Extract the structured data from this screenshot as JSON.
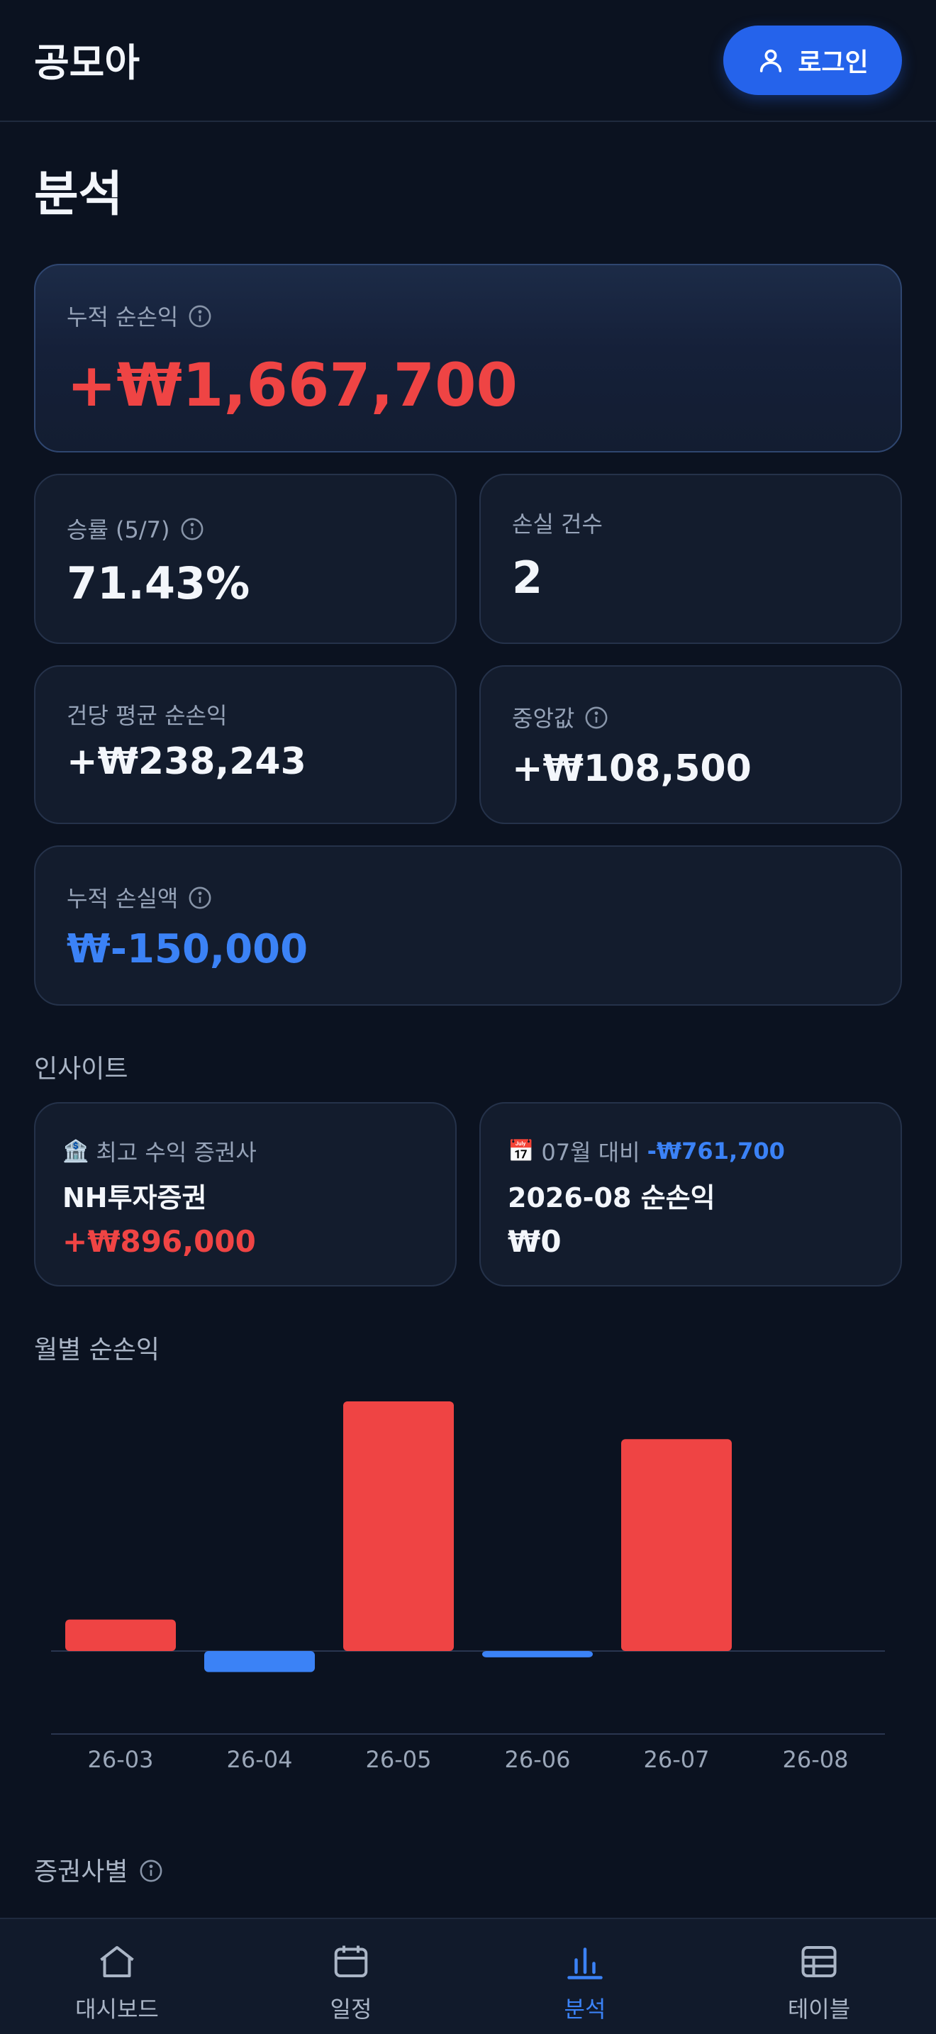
{
  "header": {
    "brand": "공모아",
    "login_label": "로그인"
  },
  "page": {
    "title": "분석"
  },
  "stats": {
    "cumulative_net": {
      "label": "누적 순손익",
      "value": "+₩1,667,700"
    },
    "win_rate": {
      "label": "승률 (5/7)",
      "value": "71.43%"
    },
    "loss_count": {
      "label": "손실 건수",
      "value": "2"
    },
    "avg_net": {
      "label": "건당 평균 순손익",
      "value": "+₩238,243"
    },
    "median": {
      "label": "중앙값",
      "value": "+₩108,500"
    },
    "cumulative_loss": {
      "label": "누적 손실액",
      "value": "₩-150,000"
    }
  },
  "insights": {
    "title": "인사이트",
    "top_broker": {
      "icon": "bank-icon",
      "label": "최고 수익 증권사",
      "name": "NH투자증권",
      "value": "+₩896,000"
    },
    "month_compare": {
      "icon": "calendar-icon",
      "label": "07월 대비",
      "delta": "-₩761,700",
      "name": "2026-08 순손익",
      "value": "₩0"
    }
  },
  "monthly": {
    "title": "월별 순손익"
  },
  "broker_section": {
    "title": "증권사별"
  },
  "chart_data": {
    "type": "bar",
    "categories": [
      "26-03",
      "26-04",
      "26-05",
      "26-06",
      "26-07",
      "26-08"
    ],
    "values": [
      150000,
      -100000,
      1190000,
      -30000,
      1010000,
      0
    ],
    "positive_color": "#ef4444",
    "negative_color": "#3b82f6",
    "title": "",
    "xlabel": "",
    "ylabel": "",
    "grid": false
  },
  "bottom_nav": [
    {
      "label": "대시보드",
      "icon": "home-icon",
      "active": false
    },
    {
      "label": "일정",
      "icon": "calendar-icon",
      "active": false
    },
    {
      "label": "분석",
      "icon": "bar-chart-icon",
      "active": true
    },
    {
      "label": "테이블",
      "icon": "table-icon",
      "active": false
    }
  ],
  "colors": {
    "background": "#0b1220",
    "accent": "#2563eb",
    "profit": "#ef4444",
    "loss": "#3b82f6"
  }
}
